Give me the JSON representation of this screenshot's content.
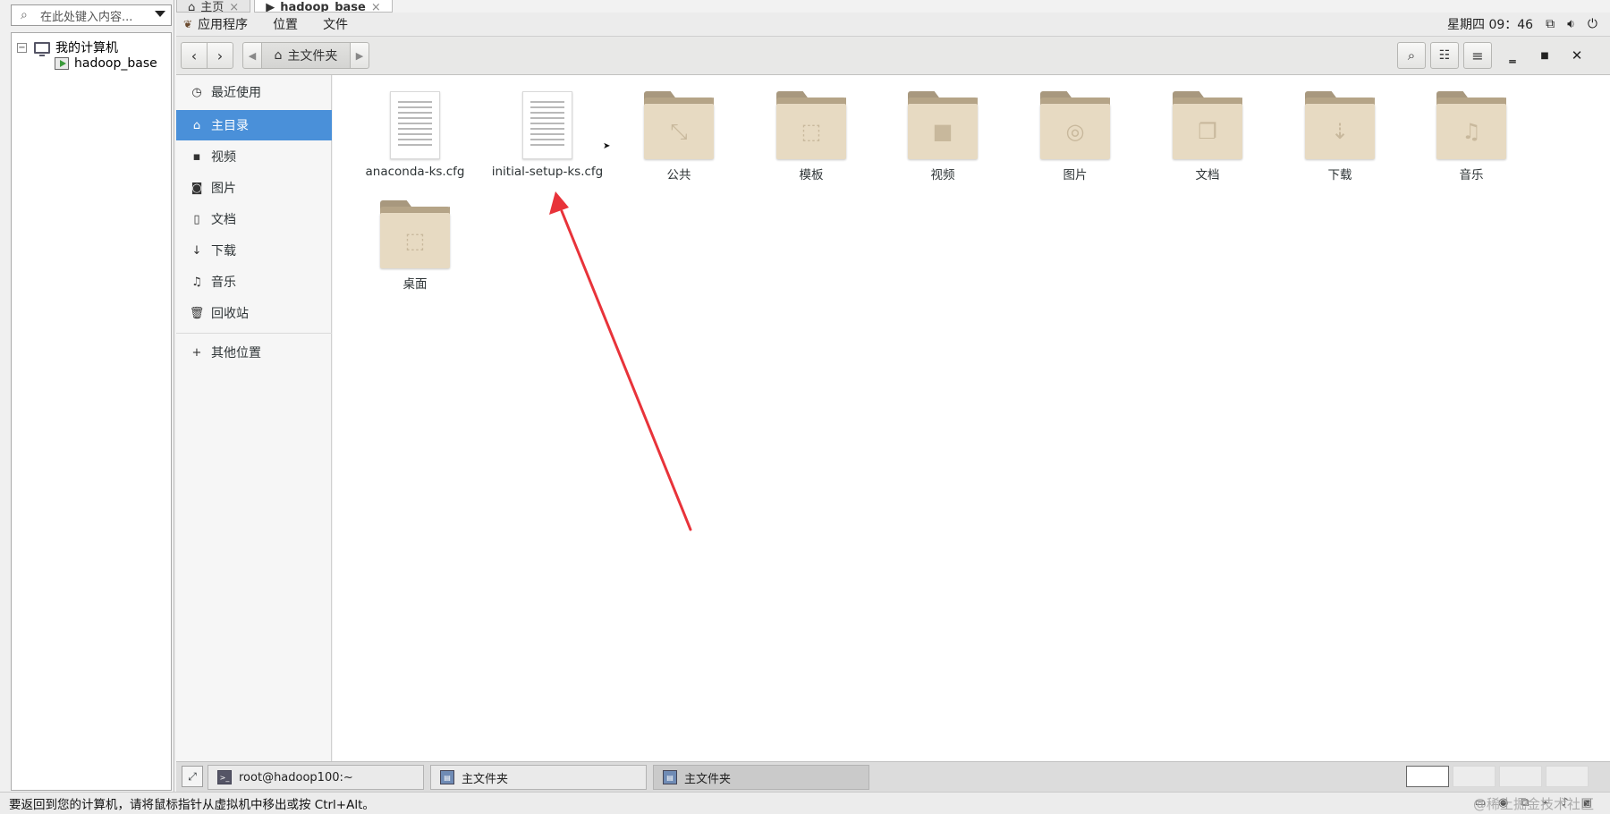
{
  "library": {
    "search_placeholder": "在此处键入内容...",
    "tree": [
      {
        "label": "我的计算机",
        "toggle": "⊟"
      },
      {
        "label": "hadoop_base"
      }
    ]
  },
  "vm_tabs": [
    {
      "label": "主页"
    },
    {
      "label": "hadoop_base"
    }
  ],
  "topbar": {
    "menus": [
      "应用程序",
      "位置",
      "文件"
    ],
    "clock": "星期四 09：46"
  },
  "header": {
    "path_home": "主文件夹"
  },
  "sidebar": {
    "items": [
      {
        "label": "最近使用",
        "icon": "clock-icon"
      },
      {
        "label": "主目录",
        "icon": "home-icon",
        "selected": true
      },
      {
        "label": "视频",
        "icon": "video-icon"
      },
      {
        "label": "图片",
        "icon": "camera-icon"
      },
      {
        "label": "文档",
        "icon": "document-icon"
      },
      {
        "label": "下载",
        "icon": "download-icon"
      },
      {
        "label": "音乐",
        "icon": "music-icon"
      },
      {
        "label": "回收站",
        "icon": "trash-icon"
      }
    ],
    "other": {
      "label": "其他位置",
      "icon": "plus-icon"
    }
  },
  "files": [
    {
      "name": "anaconda-ks.cfg",
      "type": "document"
    },
    {
      "name": "initial-setup-ks.cfg",
      "type": "document"
    },
    {
      "name": "公共",
      "type": "folder",
      "emblem": "share-icon"
    },
    {
      "name": "模板",
      "type": "folder",
      "emblem": "template-icon"
    },
    {
      "name": "视频",
      "type": "folder",
      "emblem": "video-icon"
    },
    {
      "name": "图片",
      "type": "folder",
      "emblem": "camera-icon"
    },
    {
      "name": "文档",
      "type": "folder",
      "emblem": "documents-icon"
    },
    {
      "name": "下载",
      "type": "folder",
      "emblem": "download-icon"
    },
    {
      "name": "音乐",
      "type": "folder",
      "emblem": "music-icon"
    },
    {
      "name": "桌面",
      "type": "folder",
      "emblem": "desktop-icon"
    }
  ],
  "taskbar": {
    "tasks": [
      {
        "label": "root@hadoop100:~",
        "icon": "terminal-icon"
      },
      {
        "label": "主文件夹",
        "icon": "files-icon"
      },
      {
        "label": "主文件夹",
        "icon": "files-icon",
        "active": true
      }
    ]
  },
  "status": {
    "message": "要返回到您的计算机，请将鼠标指针从虚拟机中移出或按 Ctrl+Alt。"
  },
  "colors": {
    "accent": "#4a90d9",
    "folder": "#e7dac2",
    "arrow": "#e8333a"
  }
}
